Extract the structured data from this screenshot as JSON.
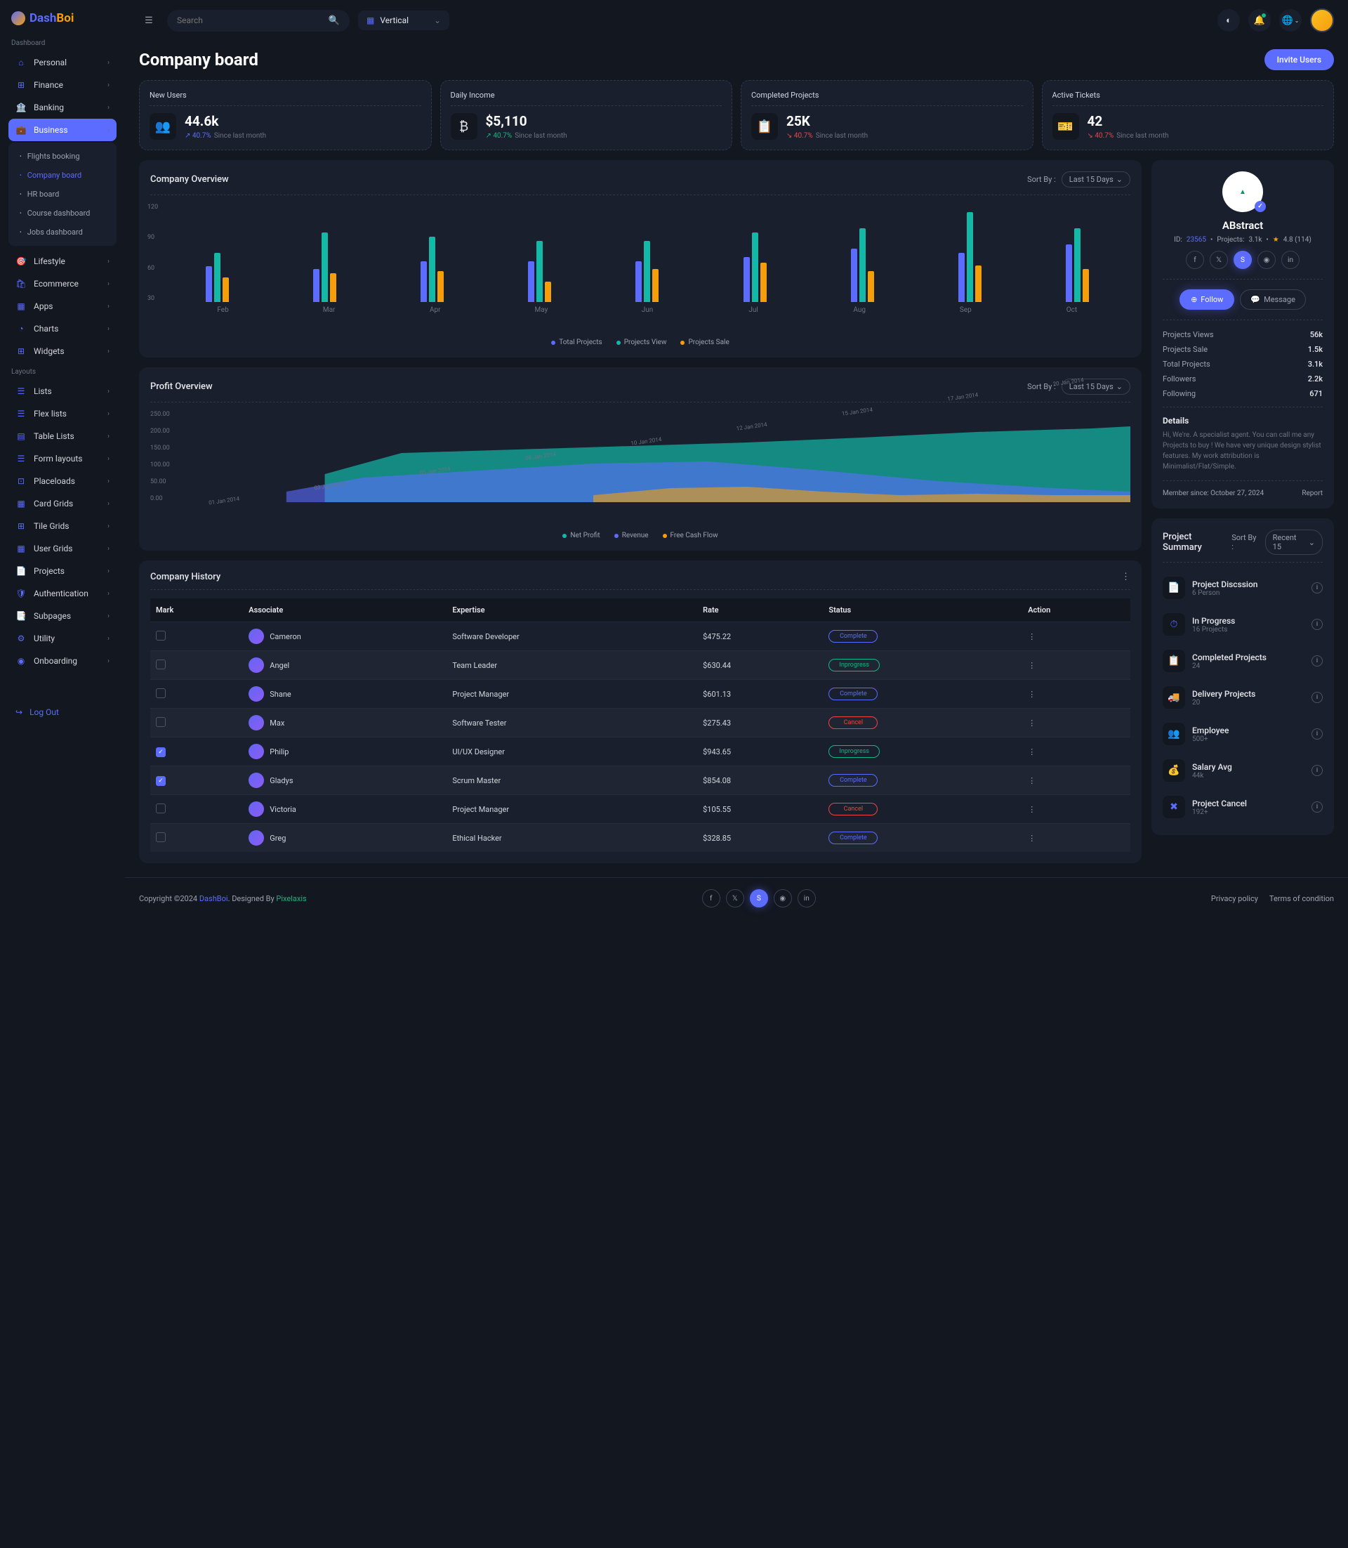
{
  "brand": {
    "dash": "Dash",
    "boi": "Boi"
  },
  "search": {
    "placeholder": "Search"
  },
  "layout_select": "Vertical",
  "sections": {
    "dashboard": "Dashboard",
    "layouts": "Layouts"
  },
  "nav": {
    "personal": "Personal",
    "finance": "Finance",
    "banking": "Banking",
    "business": "Business",
    "lifestyle": "Lifestyle",
    "ecommerce": "Ecommerce",
    "apps": "Apps",
    "charts": "Charts",
    "widgets": "Widgets",
    "lists": "Lists",
    "flexlists": "Flex lists",
    "tablelists": "Table Lists",
    "formlayouts": "Form layouts",
    "placeloads": "Placeloads",
    "cardgrids": "Card Grids",
    "tilegrids": "Tile Grids",
    "usergrids": "User Grids",
    "projects": "Projects",
    "authentication": "Authentication",
    "subpages": "Subpages",
    "utility": "Utility",
    "onboarding": "Onboarding"
  },
  "subnav": {
    "flights": "Flights booking",
    "company": "Company board",
    "hr": "HR board",
    "course": "Course dashboard",
    "jobs": "Jobs dashboard"
  },
  "logout": "Log Out",
  "page": {
    "title": "Company board",
    "invite": "Invite Users"
  },
  "stats": [
    {
      "label": "New Users",
      "value": "44.6k",
      "pct": "40.7%",
      "note": "Since last month",
      "dir": "blue",
      "icon": "👥"
    },
    {
      "label": "Daily Income",
      "value": "$5,110",
      "pct": "40.7%",
      "note": "Since last month",
      "dir": "up",
      "icon": "₿"
    },
    {
      "label": "Completed Projects",
      "value": "25K",
      "pct": "40.7%",
      "note": "Since last month",
      "dir": "down",
      "icon": "📋"
    },
    {
      "label": "Active Tickets",
      "value": "42",
      "pct": "40.7%",
      "note": "Since last month",
      "dir": "down",
      "icon": "🎫"
    }
  ],
  "overview": {
    "title": "Company Overview",
    "sort_label": "Sort By :",
    "sort_value": "Last 15 Days"
  },
  "chart_data": {
    "type": "bar",
    "categories": [
      "Feb",
      "Mar",
      "Apr",
      "May",
      "Jun",
      "Jul",
      "Aug",
      "Sep",
      "Oct"
    ],
    "y_ticks": [
      120,
      90,
      60,
      30
    ],
    "series": [
      {
        "name": "Total Projects",
        "color": "#5b6cff",
        "values": [
          44,
          40,
          50,
          50,
          50,
          55,
          65,
          60,
          70
        ]
      },
      {
        "name": "Projects View",
        "color": "#14b8a6",
        "values": [
          60,
          85,
          80,
          75,
          75,
          85,
          90,
          110,
          90
        ]
      },
      {
        "name": "Projects Sale",
        "color": "#f59e0b",
        "values": [
          30,
          35,
          38,
          25,
          40,
          48,
          38,
          45,
          40
        ]
      }
    ]
  },
  "profit": {
    "title": "Profit Overview",
    "sort_label": "Sort By :",
    "sort_value": "Last 15 Days"
  },
  "profit_chart": {
    "type": "area",
    "x": [
      "01 Jan 2014",
      "03 Jan 2014",
      "05 Jan 2014",
      "08 Jan 2014",
      "10 Jan 2014",
      "12 Jan 2014",
      "15 Jan 2014",
      "17 Jan 2014",
      "20 Jan 2014"
    ],
    "y_ticks": [
      "250.00",
      "200.00",
      "150.00",
      "100.00",
      "50.00",
      "0.00"
    ],
    "series": [
      {
        "name": "Net Profit",
        "color": "#14b8a6"
      },
      {
        "name": "Revenue",
        "color": "#5b6cff"
      },
      {
        "name": "Free Cash Flow",
        "color": "#f59e0b"
      }
    ]
  },
  "profile": {
    "name": "ABstract",
    "id_label": "ID:",
    "id": "23565",
    "projects_label": "Projects:",
    "projects": "3.1k",
    "rating": "4.8 (114)",
    "follow": "Follow",
    "message": "Message",
    "stats": [
      {
        "k": "Projects Views",
        "v": "56k"
      },
      {
        "k": "Projects Sale",
        "v": "1.5k"
      },
      {
        "k": "Total Projects",
        "v": "3.1k"
      },
      {
        "k": "Followers",
        "v": "2.2k"
      },
      {
        "k": "Following",
        "v": "671"
      }
    ],
    "details_title": "Details",
    "details_text": "Hi, We're. A specialist agent. You can call me any Projects to buy ! We have very unique design stylist features. My work attribution is Minimalist/Flat/Simple.",
    "member_since": "Member since: October 27, 2024",
    "report": "Report"
  },
  "history": {
    "title": "Company History",
    "cols": {
      "mark": "Mark",
      "associate": "Associate",
      "expertise": "Expertise",
      "rate": "Rate",
      "status": "Status",
      "action": "Action"
    },
    "rows": [
      {
        "checked": false,
        "name": "Cameron",
        "expertise": "Software Developer",
        "rate": "$475.22",
        "status": "Complete",
        "statusClass": "complete"
      },
      {
        "checked": false,
        "name": "Angel",
        "expertise": "Team Leader",
        "rate": "$630.44",
        "status": "Inprogress",
        "statusClass": "inprogress"
      },
      {
        "checked": false,
        "name": "Shane",
        "expertise": "Project Manager",
        "rate": "$601.13",
        "status": "Complete",
        "statusClass": "complete"
      },
      {
        "checked": false,
        "name": "Max",
        "expertise": "Software Tester",
        "rate": "$275.43",
        "status": "Cancel",
        "statusClass": "cancel"
      },
      {
        "checked": true,
        "name": "Philip",
        "expertise": "UI/UX Designer",
        "rate": "$943.65",
        "status": "Inprogress",
        "statusClass": "inprogress"
      },
      {
        "checked": true,
        "name": "Gladys",
        "expertise": "Scrum Master",
        "rate": "$854.08",
        "status": "Complete",
        "statusClass": "complete"
      },
      {
        "checked": false,
        "name": "Victoria",
        "expertise": "Project Manager",
        "rate": "$105.55",
        "status": "Cancel",
        "statusClass": "cancel"
      },
      {
        "checked": false,
        "name": "Greg",
        "expertise": "Ethical Hacker",
        "rate": "$328.85",
        "status": "Complete",
        "statusClass": "complete"
      }
    ]
  },
  "summary": {
    "title": "Project Summary",
    "sort_label": "Sort By :",
    "sort_value": "Recent 15",
    "items": [
      {
        "title": "Project Discssion",
        "sub": "6 Person",
        "icon": "📄"
      },
      {
        "title": "In Progress",
        "sub": "16 Projects",
        "icon": "⏱"
      },
      {
        "title": "Completed Projects",
        "sub": "24",
        "icon": "📋"
      },
      {
        "title": "Delivery Projects",
        "sub": "20",
        "icon": "🚚"
      },
      {
        "title": "Employee",
        "sub": "500+",
        "icon": "👥"
      },
      {
        "title": "Salary Avg",
        "sub": "44k",
        "icon": "💰"
      },
      {
        "title": "Project Cancel",
        "sub": "192+",
        "icon": "✖"
      }
    ]
  },
  "footer": {
    "copyright": "Copyright ©2024 ",
    "brand": "DashBoi",
    "designed": ". Designed By ",
    "designer": "Pixelaxis",
    "privacy": "Privacy policy",
    "terms": "Terms of condition"
  }
}
